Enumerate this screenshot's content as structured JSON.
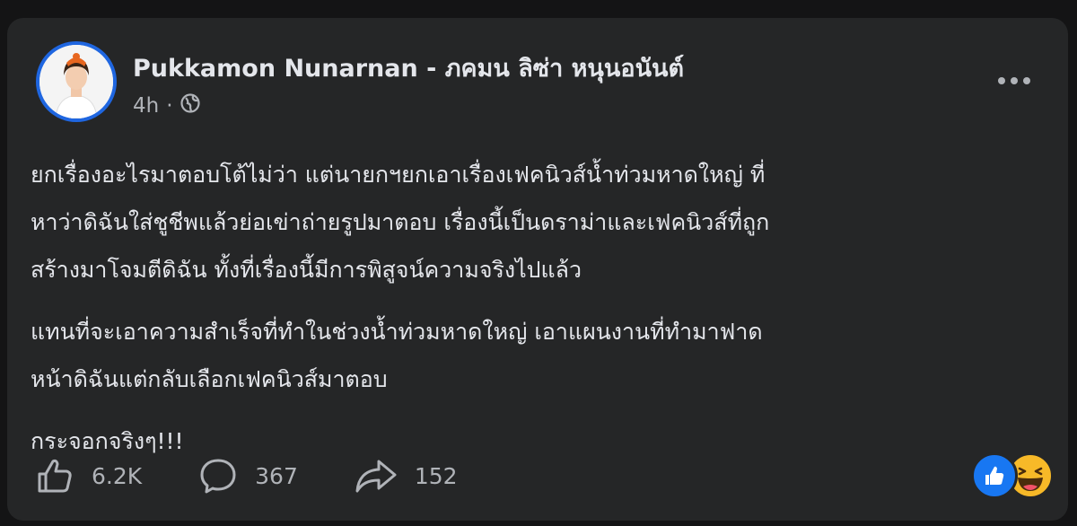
{
  "post": {
    "author": "Pukkamon Nunarnan - ภคมน ลิซ่า หนุนอนันต์",
    "time": "4h",
    "separator": "·",
    "privacy_icon": "globe-icon",
    "paragraphs": [
      "ยกเรื่องอะไรมาตอบโต้ไม่ว่า แต่นายกฯยกเอาเรื่องเฟคนิวส์น้ำท่วมหาดใหญ่ ที่\nหาว่าดิฉันใส่ชูชีพแล้วย่อเข่าถ่ายรูปมาตอบ เรื่องนี้เป็นดราม่าและเฟคนิวส์ที่ถูก\nสร้างมาโจมตีดิฉัน ทั้งที่เรื่องนี้มีการพิสูจน์ความจริงไปแล้ว",
      "แทนที่จะเอาความสำเร็จที่ทำในช่วงน้ำท่วมหาดใหญ่ เอาแผนงานที่ทำมาฟาด\nหน้าดิฉันแต่กลับเลือกเฟคนิวส์มาตอบ",
      "กระจอกจริงๆ!!!"
    ]
  },
  "actions": {
    "likes": "6.2K",
    "comments": "367",
    "shares": "152"
  },
  "reactions": [
    "like-reaction-icon",
    "haha-reaction-icon"
  ],
  "colors": {
    "background": "#141415",
    "card": "#252627",
    "text": "#e4e6eb",
    "secondary": "#b0b3b8",
    "like_blue": "#1877f2",
    "haha_yellow": "#f7b928"
  }
}
